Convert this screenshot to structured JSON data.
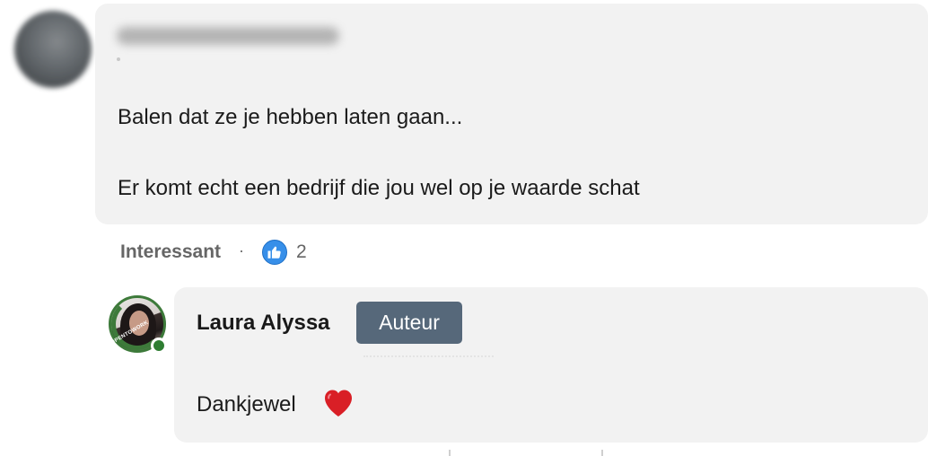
{
  "comment": {
    "author_name": "",
    "lines": [
      "Balen dat ze je hebben laten gaan...",
      "Er komt echt een bedrijf die jou wel op je waarde schat"
    ],
    "actions": {
      "react_label": "Interessant",
      "separator": "·",
      "reaction_icon": "insightful-reaction-icon",
      "reaction_count": "2"
    }
  },
  "reply": {
    "author_name": "Laura Alyssa",
    "badge": "Auteur",
    "text": "Dankjewel",
    "emoji_icon": "red-heart-icon",
    "avatar_frame": "OPENTOWORK",
    "status": "online"
  },
  "colors": {
    "bubble_bg": "#f2f2f2",
    "badge_bg": "#56687a",
    "reaction_blue": "#378fe9",
    "open_to_work_green": "#3d7a3a",
    "online_green": "#2e7d32",
    "heart_red": "#d91f26"
  }
}
